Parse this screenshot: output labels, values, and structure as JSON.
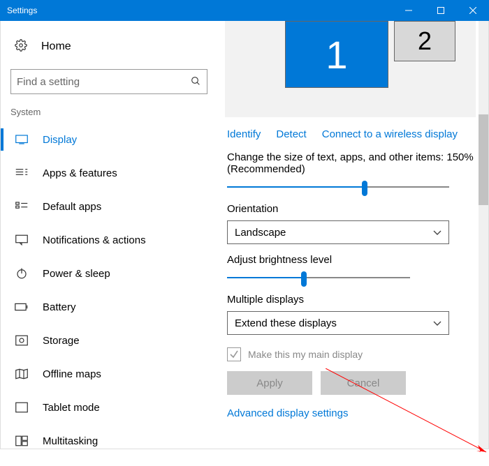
{
  "window": {
    "title": "Settings"
  },
  "sidebar": {
    "home": "Home",
    "search_placeholder": "Find a setting",
    "section": "System",
    "items": [
      {
        "label": "Display",
        "active": true
      },
      {
        "label": "Apps & features"
      },
      {
        "label": "Default apps"
      },
      {
        "label": "Notifications & actions"
      },
      {
        "label": "Power & sleep"
      },
      {
        "label": "Battery"
      },
      {
        "label": "Storage"
      },
      {
        "label": "Offline maps"
      },
      {
        "label": "Tablet mode"
      },
      {
        "label": "Multitasking"
      }
    ]
  },
  "main": {
    "monitors": {
      "primary": "1",
      "secondary": "2"
    },
    "links": {
      "identify": "Identify",
      "detect": "Detect",
      "wireless": "Connect to a wireless display"
    },
    "scale_label": "Change the size of text, apps, and other items: 150% (Recommended)",
    "scale_value_pct": 62,
    "orientation_label": "Orientation",
    "orientation_value": "Landscape",
    "brightness_label": "Adjust brightness level",
    "brightness_value_pct": 42,
    "multi_label": "Multiple displays",
    "multi_value": "Extend these displays",
    "main_checkbox": "Make this my main display",
    "apply": "Apply",
    "cancel": "Cancel",
    "advanced": "Advanced display settings"
  }
}
